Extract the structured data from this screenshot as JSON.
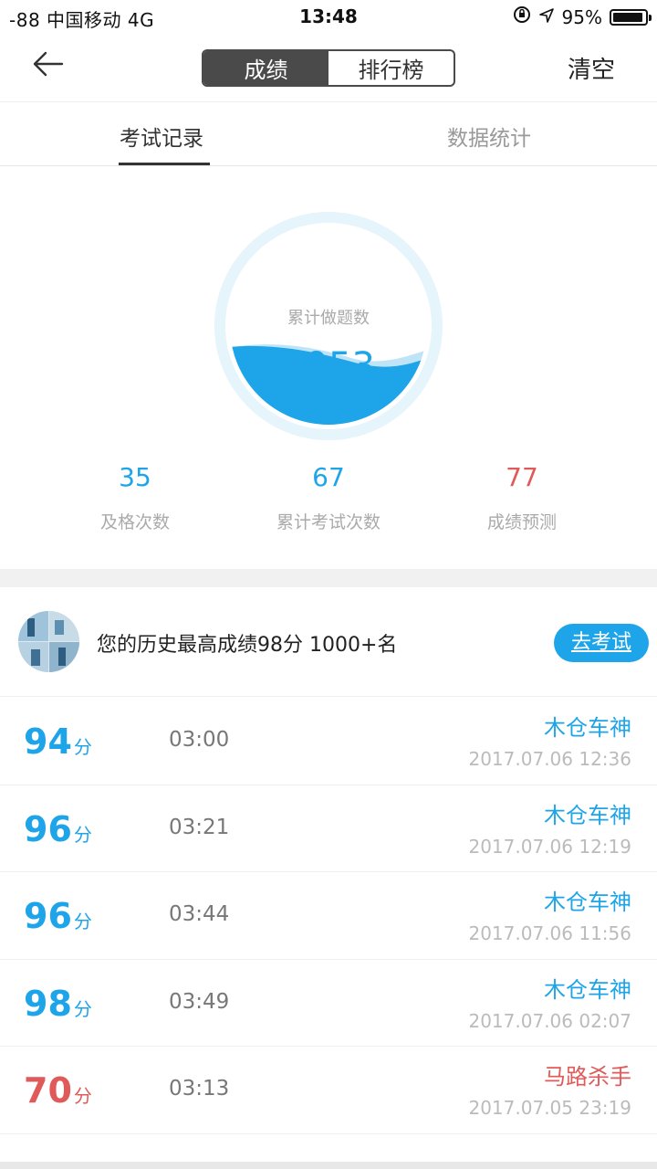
{
  "status_bar": {
    "carrier": "-88 中国移动   4G",
    "time": "13:48",
    "battery": "95%",
    "battery_level": 0.95
  },
  "nav": {
    "segments": [
      "成绩",
      "排行榜"
    ],
    "active_segment": 0,
    "clear_label": "清空"
  },
  "tabs": [
    "考试记录",
    "数据统计"
  ],
  "summary": {
    "gauge_label": "累计做题数",
    "gauge_value": "2953",
    "stats": [
      {
        "value": "35",
        "label": "及格次数"
      },
      {
        "value": "67",
        "label": "累计考试次数"
      },
      {
        "value": "77",
        "label": "成绩预测"
      }
    ]
  },
  "best": {
    "text": "您的历史最高成绩98分 1000+名",
    "button": "去考试"
  },
  "records": [
    {
      "score": "94",
      "unit": "分",
      "duration": "03:00",
      "user": "木仓车神",
      "date": "2017.07.06 12:36"
    },
    {
      "score": "96",
      "unit": "分",
      "duration": "03:21",
      "user": "木仓车神",
      "date": "2017.07.06 12:19"
    },
    {
      "score": "96",
      "unit": "分",
      "duration": "03:44",
      "user": "木仓车神",
      "date": "2017.07.06 11:56"
    },
    {
      "score": "98",
      "unit": "分",
      "duration": "03:49",
      "user": "木仓车神",
      "date": "2017.07.06 02:07"
    },
    {
      "score": "70",
      "unit": "分",
      "duration": "03:13",
      "user": "马路杀手",
      "date": "2017.07.05 23:19"
    }
  ],
  "colors": {
    "accent": "#1ea4e9",
    "fail": "#e05a5a"
  },
  "icons": {
    "back": "arrow-left-icon",
    "location": "location-arrow-icon",
    "lock_rotation": "rotation-lock-icon"
  }
}
